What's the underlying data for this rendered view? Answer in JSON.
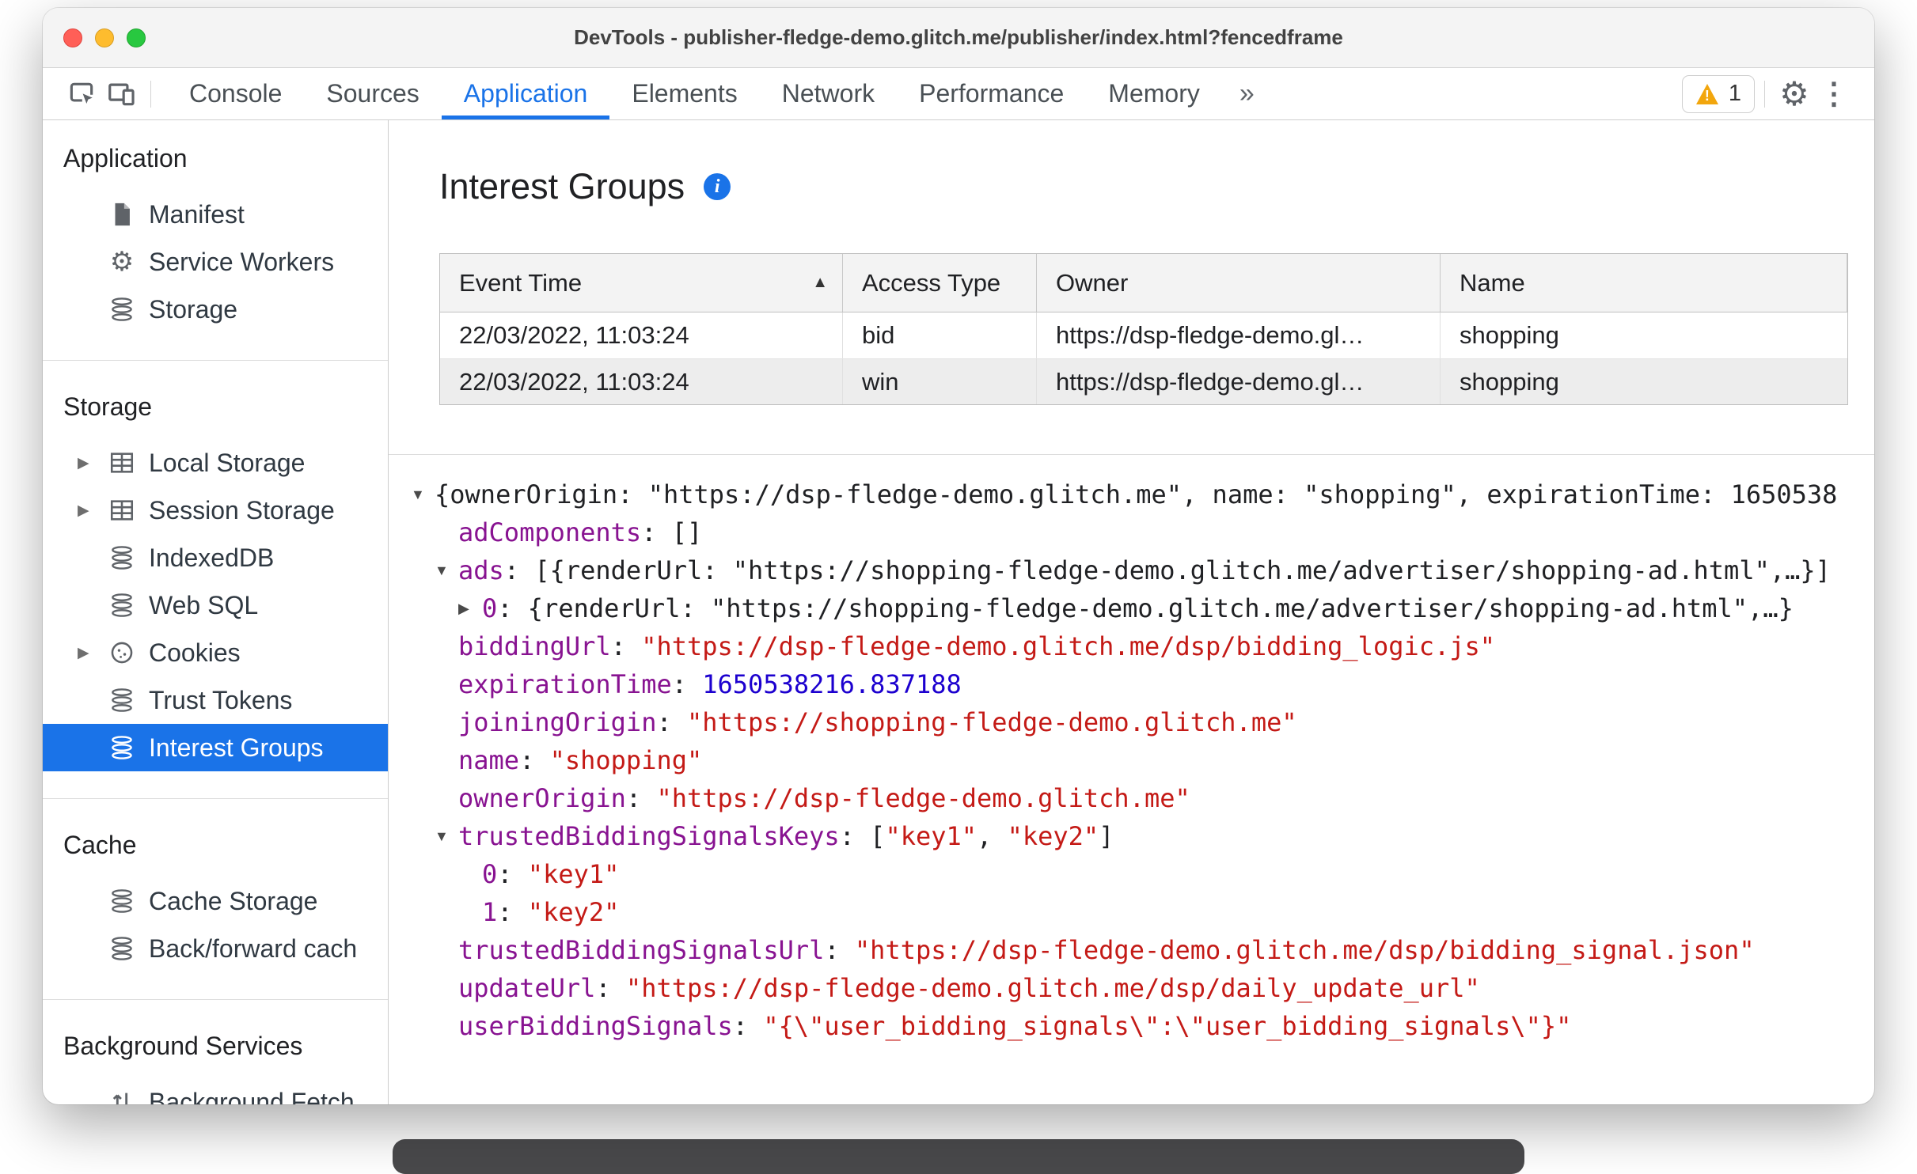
{
  "window": {
    "title": "DevTools - publisher-fledge-demo.glitch.me/publisher/index.html?fencedframe"
  },
  "toolbar": {
    "tabs": [
      {
        "label": "Console",
        "active": false
      },
      {
        "label": "Sources",
        "active": false
      },
      {
        "label": "Application",
        "active": true
      },
      {
        "label": "Elements",
        "active": false
      },
      {
        "label": "Network",
        "active": false
      },
      {
        "label": "Performance",
        "active": false
      },
      {
        "label": "Memory",
        "active": false
      }
    ],
    "more_tabs_symbol": "»",
    "warning_count": "1"
  },
  "sidebar": {
    "sections": [
      {
        "header": "Application",
        "items": [
          {
            "label": "Manifest",
            "icon": "manifest"
          },
          {
            "label": "Service Workers",
            "icon": "gear"
          },
          {
            "label": "Storage",
            "icon": "database"
          }
        ]
      },
      {
        "header": "Storage",
        "items": [
          {
            "label": "Local Storage",
            "icon": "table",
            "expandable": true
          },
          {
            "label": "Session Storage",
            "icon": "table",
            "expandable": true
          },
          {
            "label": "IndexedDB",
            "icon": "database"
          },
          {
            "label": "Web SQL",
            "icon": "database"
          },
          {
            "label": "Cookies",
            "icon": "cookie",
            "expandable": true
          },
          {
            "label": "Trust Tokens",
            "icon": "database"
          },
          {
            "label": "Interest Groups",
            "icon": "database",
            "selected": true
          }
        ]
      },
      {
        "header": "Cache",
        "items": [
          {
            "label": "Cache Storage",
            "icon": "database"
          },
          {
            "label": "Back/forward cach",
            "icon": "database"
          }
        ]
      },
      {
        "header": "Background Services",
        "items": [
          {
            "label": "Background Fetch",
            "icon": "fetch"
          }
        ]
      }
    ]
  },
  "main": {
    "title": "Interest Groups",
    "table": {
      "columns": [
        "Event Time",
        "Access Type",
        "Owner",
        "Name"
      ],
      "sort_column": "Event Time",
      "rows": [
        [
          "22/03/2022, 11:03:24",
          "bid",
          "https://dsp-fledge-demo.gl…",
          "shopping"
        ],
        [
          "22/03/2022, 11:03:24",
          "win",
          "https://dsp-fledge-demo.gl…",
          "shopping"
        ]
      ]
    },
    "tree": [
      {
        "indent": 0,
        "arrow": "down",
        "segments": [
          {
            "c": "plain",
            "t": "{ownerOrigin: \"https://dsp-fledge-demo.glitch.me\", name: \"shopping\", expirationTime: 1650538"
          }
        ]
      },
      {
        "indent": 1,
        "arrow": null,
        "segments": [
          {
            "c": "key",
            "t": "adComponents"
          },
          {
            "c": "plain",
            "t": ": []"
          }
        ]
      },
      {
        "indent": 1,
        "arrow": "down",
        "segments": [
          {
            "c": "key",
            "t": "ads"
          },
          {
            "c": "plain",
            "t": ": [{renderUrl: \"https://shopping-fledge-demo.glitch.me/advertiser/shopping-ad.html\",…}]"
          }
        ]
      },
      {
        "indent": 2,
        "arrow": "right",
        "segments": [
          {
            "c": "key",
            "t": "0"
          },
          {
            "c": "plain",
            "t": ": {renderUrl: \"https://shopping-fledge-demo.glitch.me/advertiser/shopping-ad.html\",…}"
          }
        ]
      },
      {
        "indent": 1,
        "arrow": null,
        "segments": [
          {
            "c": "key",
            "t": "biddingUrl"
          },
          {
            "c": "plain",
            "t": ": "
          },
          {
            "c": "str",
            "t": "\"https://dsp-fledge-demo.glitch.me/dsp/bidding_logic.js\""
          }
        ]
      },
      {
        "indent": 1,
        "arrow": null,
        "segments": [
          {
            "c": "key",
            "t": "expirationTime"
          },
          {
            "c": "plain",
            "t": ": "
          },
          {
            "c": "num",
            "t": "1650538216.837188"
          }
        ]
      },
      {
        "indent": 1,
        "arrow": null,
        "segments": [
          {
            "c": "key",
            "t": "joiningOrigin"
          },
          {
            "c": "plain",
            "t": ": "
          },
          {
            "c": "str",
            "t": "\"https://shopping-fledge-demo.glitch.me\""
          }
        ]
      },
      {
        "indent": 1,
        "arrow": null,
        "segments": [
          {
            "c": "key",
            "t": "name"
          },
          {
            "c": "plain",
            "t": ": "
          },
          {
            "c": "str",
            "t": "\"shopping\""
          }
        ]
      },
      {
        "indent": 1,
        "arrow": null,
        "segments": [
          {
            "c": "key",
            "t": "ownerOrigin"
          },
          {
            "c": "plain",
            "t": ": "
          },
          {
            "c": "str",
            "t": "\"https://dsp-fledge-demo.glitch.me\""
          }
        ]
      },
      {
        "indent": 1,
        "arrow": "down",
        "segments": [
          {
            "c": "key",
            "t": "trustedBiddingSignalsKeys"
          },
          {
            "c": "plain",
            "t": ": ["
          },
          {
            "c": "str",
            "t": "\"key1\""
          },
          {
            "c": "plain",
            "t": ", "
          },
          {
            "c": "str",
            "t": "\"key2\""
          },
          {
            "c": "plain",
            "t": "]"
          }
        ]
      },
      {
        "indent": 2,
        "arrow": null,
        "segments": [
          {
            "c": "key",
            "t": "0"
          },
          {
            "c": "plain",
            "t": ": "
          },
          {
            "c": "str",
            "t": "\"key1\""
          }
        ]
      },
      {
        "indent": 2,
        "arrow": null,
        "segments": [
          {
            "c": "key",
            "t": "1"
          },
          {
            "c": "plain",
            "t": ": "
          },
          {
            "c": "str",
            "t": "\"key2\""
          }
        ]
      },
      {
        "indent": 1,
        "arrow": null,
        "segments": [
          {
            "c": "key",
            "t": "trustedBiddingSignalsUrl"
          },
          {
            "c": "plain",
            "t": ": "
          },
          {
            "c": "str",
            "t": "\"https://dsp-fledge-demo.glitch.me/dsp/bidding_signal.json\""
          }
        ]
      },
      {
        "indent": 1,
        "arrow": null,
        "segments": [
          {
            "c": "key",
            "t": "updateUrl"
          },
          {
            "c": "plain",
            "t": ": "
          },
          {
            "c": "str",
            "t": "\"https://dsp-fledge-demo.glitch.me/dsp/daily_update_url\""
          }
        ]
      },
      {
        "indent": 1,
        "arrow": null,
        "segments": [
          {
            "c": "key",
            "t": "userBiddingSignals"
          },
          {
            "c": "plain",
            "t": ": "
          },
          {
            "c": "str",
            "t": "\"{\\\"user_bidding_signals\\\":\\\"user_bidding_signals\\\"}\""
          }
        ]
      }
    ]
  },
  "colors": {
    "accent": "#1a73e8",
    "key": "#881391",
    "string": "#c41a16",
    "number": "#1c00cf",
    "warning": "#f2a60d"
  }
}
